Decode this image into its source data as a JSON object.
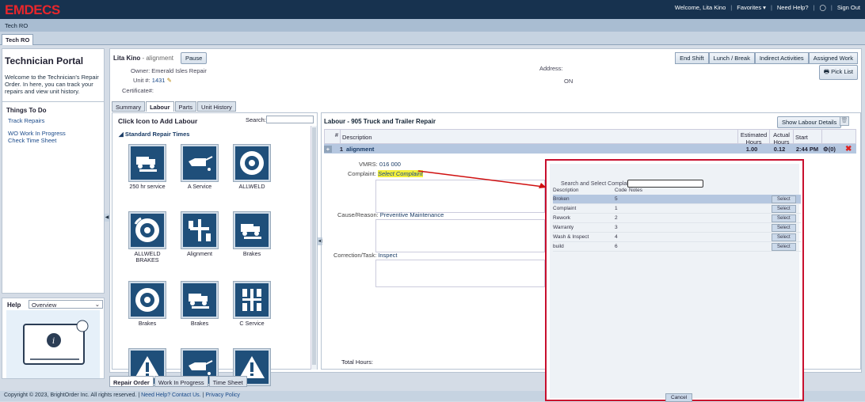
{
  "app": {
    "logo": "EMDECS"
  },
  "topnav": {
    "welcome": "Welcome, Lita Kino",
    "favorites": "Favorites ▾",
    "help": "Need Help?",
    "signout": "Sign Out"
  },
  "subbar": {
    "title": "Tech RO"
  },
  "tab": {
    "label": "Tech RO"
  },
  "left": {
    "title": "Technician Portal",
    "desc": "Welcome to the Technician's Repair Order. In here, you can track your repairs and view unit history.",
    "todo_title": "Things To Do",
    "links": [
      "Track Repairs",
      "WO Work In Progress",
      "Check Time Sheet"
    ],
    "help_label": "Help",
    "help_select": "Overview"
  },
  "main": {
    "tech_name": "Lita Kino",
    "job": "- alignment",
    "pause": "Pause",
    "owner_label": "Owner:",
    "owner": "Emerald Isles Repair",
    "unit_label": "Unit #:",
    "unit": "1431",
    "cert_label": "Certificate#:",
    "address_label": "Address:",
    "address_value": "ON",
    "actions": [
      "End Shift",
      "Lunch / Break",
      "Indirect Activities",
      "Assigned Work"
    ],
    "pick_list": "Pick List",
    "subtabs": [
      "Summary",
      "Labour",
      "Parts",
      "Unit History"
    ]
  },
  "labour": {
    "heading": "Click Icon to Add Labour",
    "search_label": "Search:",
    "section": "Standard Repair Times",
    "cards": [
      {
        "label": "250 hr service",
        "icon": "truck-wrench-icon"
      },
      {
        "label": "A Service",
        "icon": "oil-can-icon"
      },
      {
        "label": "ALLWELD",
        "icon": "wheel-icon"
      },
      {
        "label": "ALLWELD BRAKES",
        "icon": "brake-icon"
      },
      {
        "label": "Alignment",
        "icon": "alignment-icon"
      },
      {
        "label": "Brakes",
        "icon": "truck-wrench-icon"
      },
      {
        "label": "Brakes",
        "icon": "wheel-icon"
      },
      {
        "label": "Brakes",
        "icon": "truck-wrench-icon"
      },
      {
        "label": "C Service",
        "icon": "axle-icon"
      },
      {
        "label": "",
        "icon": "warning-icon"
      },
      {
        "label": "",
        "icon": "oil-can-icon"
      },
      {
        "label": "",
        "icon": "warning-icon"
      }
    ]
  },
  "detail": {
    "title": "Labour - 905 Truck and Trailer Repair",
    "show_btn": "Show Labour Details",
    "cols": [
      "#",
      "Description",
      "Estimated Hours",
      "Actual Hours",
      "Start"
    ],
    "row": {
      "num": "1",
      "desc": "alignment",
      "est": "1.00",
      "act": "0.12",
      "start": "2:44 PM",
      "count": "(0)"
    },
    "vmrs_label": "VMRS:",
    "vmrs": "016 000",
    "complaint_label": "Complaint:",
    "complaint": "Select Complaint",
    "cause_label": "Cause/Reason:",
    "cause": "Preventive Maintenance",
    "correction_label": "Correction/Task:",
    "correction": "Inspect",
    "total_label": "Total Hours:"
  },
  "bottomtabs": [
    "Repair Order",
    "Work In Progress",
    "Time Sheet"
  ],
  "footer": {
    "copy": "Copyright © 2023, BrightOrder Inc. All rights reserved.",
    "help": "Need Help? Contact Us.",
    "privacy": "Privacy Policy"
  },
  "popup": {
    "search_label": "Search and Select Complaint:",
    "cols": [
      "Description",
      "Code",
      "Notes"
    ],
    "rows": [
      {
        "desc": "Broken",
        "code": "5"
      },
      {
        "desc": "Complaint",
        "code": "1"
      },
      {
        "desc": "Rework",
        "code": "2"
      },
      {
        "desc": "Warranty",
        "code": "3"
      },
      {
        "desc": "Wash & Inspect",
        "code": "4"
      },
      {
        "desc": "build",
        "code": "6"
      }
    ],
    "select_label": "Select",
    "cancel": "Cancel"
  },
  "colors": {
    "brand": "#e8262b",
    "header": "#17324f",
    "highlight_border": "#c8102e"
  }
}
